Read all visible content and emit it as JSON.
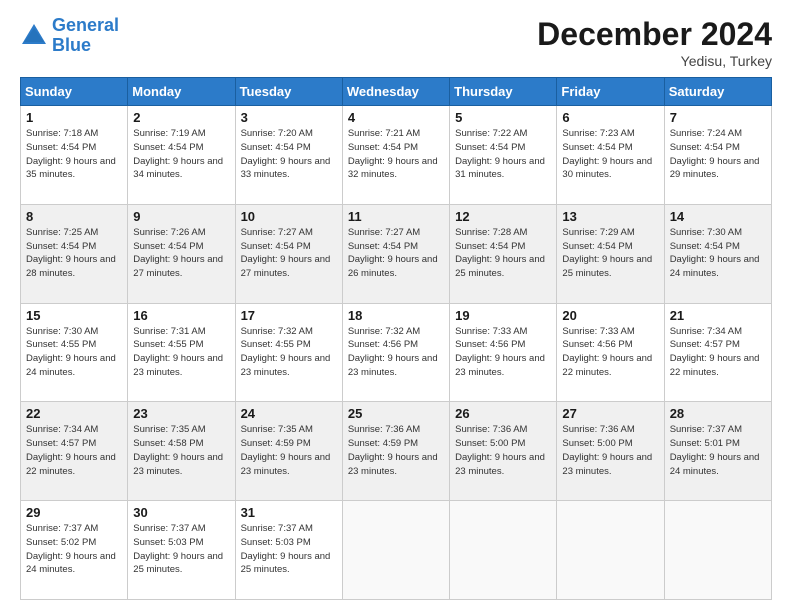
{
  "header": {
    "logo_line1": "General",
    "logo_line2": "Blue",
    "month_title": "December 2024",
    "location": "Yedisu, Turkey"
  },
  "days_of_week": [
    "Sunday",
    "Monday",
    "Tuesday",
    "Wednesday",
    "Thursday",
    "Friday",
    "Saturday"
  ],
  "weeks": [
    [
      {
        "day": "1",
        "sunrise": "7:18 AM",
        "sunset": "4:54 PM",
        "daylight": "9 hours and 35 minutes."
      },
      {
        "day": "2",
        "sunrise": "7:19 AM",
        "sunset": "4:54 PM",
        "daylight": "9 hours and 34 minutes."
      },
      {
        "day": "3",
        "sunrise": "7:20 AM",
        "sunset": "4:54 PM",
        "daylight": "9 hours and 33 minutes."
      },
      {
        "day": "4",
        "sunrise": "7:21 AM",
        "sunset": "4:54 PM",
        "daylight": "9 hours and 32 minutes."
      },
      {
        "day": "5",
        "sunrise": "7:22 AM",
        "sunset": "4:54 PM",
        "daylight": "9 hours and 31 minutes."
      },
      {
        "day": "6",
        "sunrise": "7:23 AM",
        "sunset": "4:54 PM",
        "daylight": "9 hours and 30 minutes."
      },
      {
        "day": "7",
        "sunrise": "7:24 AM",
        "sunset": "4:54 PM",
        "daylight": "9 hours and 29 minutes."
      }
    ],
    [
      {
        "day": "8",
        "sunrise": "7:25 AM",
        "sunset": "4:54 PM",
        "daylight": "9 hours and 28 minutes."
      },
      {
        "day": "9",
        "sunrise": "7:26 AM",
        "sunset": "4:54 PM",
        "daylight": "9 hours and 27 minutes."
      },
      {
        "day": "10",
        "sunrise": "7:27 AM",
        "sunset": "4:54 PM",
        "daylight": "9 hours and 27 minutes."
      },
      {
        "day": "11",
        "sunrise": "7:27 AM",
        "sunset": "4:54 PM",
        "daylight": "9 hours and 26 minutes."
      },
      {
        "day": "12",
        "sunrise": "7:28 AM",
        "sunset": "4:54 PM",
        "daylight": "9 hours and 25 minutes."
      },
      {
        "day": "13",
        "sunrise": "7:29 AM",
        "sunset": "4:54 PM",
        "daylight": "9 hours and 25 minutes."
      },
      {
        "day": "14",
        "sunrise": "7:30 AM",
        "sunset": "4:54 PM",
        "daylight": "9 hours and 24 minutes."
      }
    ],
    [
      {
        "day": "15",
        "sunrise": "7:30 AM",
        "sunset": "4:55 PM",
        "daylight": "9 hours and 24 minutes."
      },
      {
        "day": "16",
        "sunrise": "7:31 AM",
        "sunset": "4:55 PM",
        "daylight": "9 hours and 23 minutes."
      },
      {
        "day": "17",
        "sunrise": "7:32 AM",
        "sunset": "4:55 PM",
        "daylight": "9 hours and 23 minutes."
      },
      {
        "day": "18",
        "sunrise": "7:32 AM",
        "sunset": "4:56 PM",
        "daylight": "9 hours and 23 minutes."
      },
      {
        "day": "19",
        "sunrise": "7:33 AM",
        "sunset": "4:56 PM",
        "daylight": "9 hours and 23 minutes."
      },
      {
        "day": "20",
        "sunrise": "7:33 AM",
        "sunset": "4:56 PM",
        "daylight": "9 hours and 22 minutes."
      },
      {
        "day": "21",
        "sunrise": "7:34 AM",
        "sunset": "4:57 PM",
        "daylight": "9 hours and 22 minutes."
      }
    ],
    [
      {
        "day": "22",
        "sunrise": "7:34 AM",
        "sunset": "4:57 PM",
        "daylight": "9 hours and 22 minutes."
      },
      {
        "day": "23",
        "sunrise": "7:35 AM",
        "sunset": "4:58 PM",
        "daylight": "9 hours and 23 minutes."
      },
      {
        "day": "24",
        "sunrise": "7:35 AM",
        "sunset": "4:59 PM",
        "daylight": "9 hours and 23 minutes."
      },
      {
        "day": "25",
        "sunrise": "7:36 AM",
        "sunset": "4:59 PM",
        "daylight": "9 hours and 23 minutes."
      },
      {
        "day": "26",
        "sunrise": "7:36 AM",
        "sunset": "5:00 PM",
        "daylight": "9 hours and 23 minutes."
      },
      {
        "day": "27",
        "sunrise": "7:36 AM",
        "sunset": "5:00 PM",
        "daylight": "9 hours and 23 minutes."
      },
      {
        "day": "28",
        "sunrise": "7:37 AM",
        "sunset": "5:01 PM",
        "daylight": "9 hours and 24 minutes."
      }
    ],
    [
      {
        "day": "29",
        "sunrise": "7:37 AM",
        "sunset": "5:02 PM",
        "daylight": "9 hours and 24 minutes."
      },
      {
        "day": "30",
        "sunrise": "7:37 AM",
        "sunset": "5:03 PM",
        "daylight": "9 hours and 25 minutes."
      },
      {
        "day": "31",
        "sunrise": "7:37 AM",
        "sunset": "5:03 PM",
        "daylight": "9 hours and 25 minutes."
      },
      null,
      null,
      null,
      null
    ]
  ]
}
